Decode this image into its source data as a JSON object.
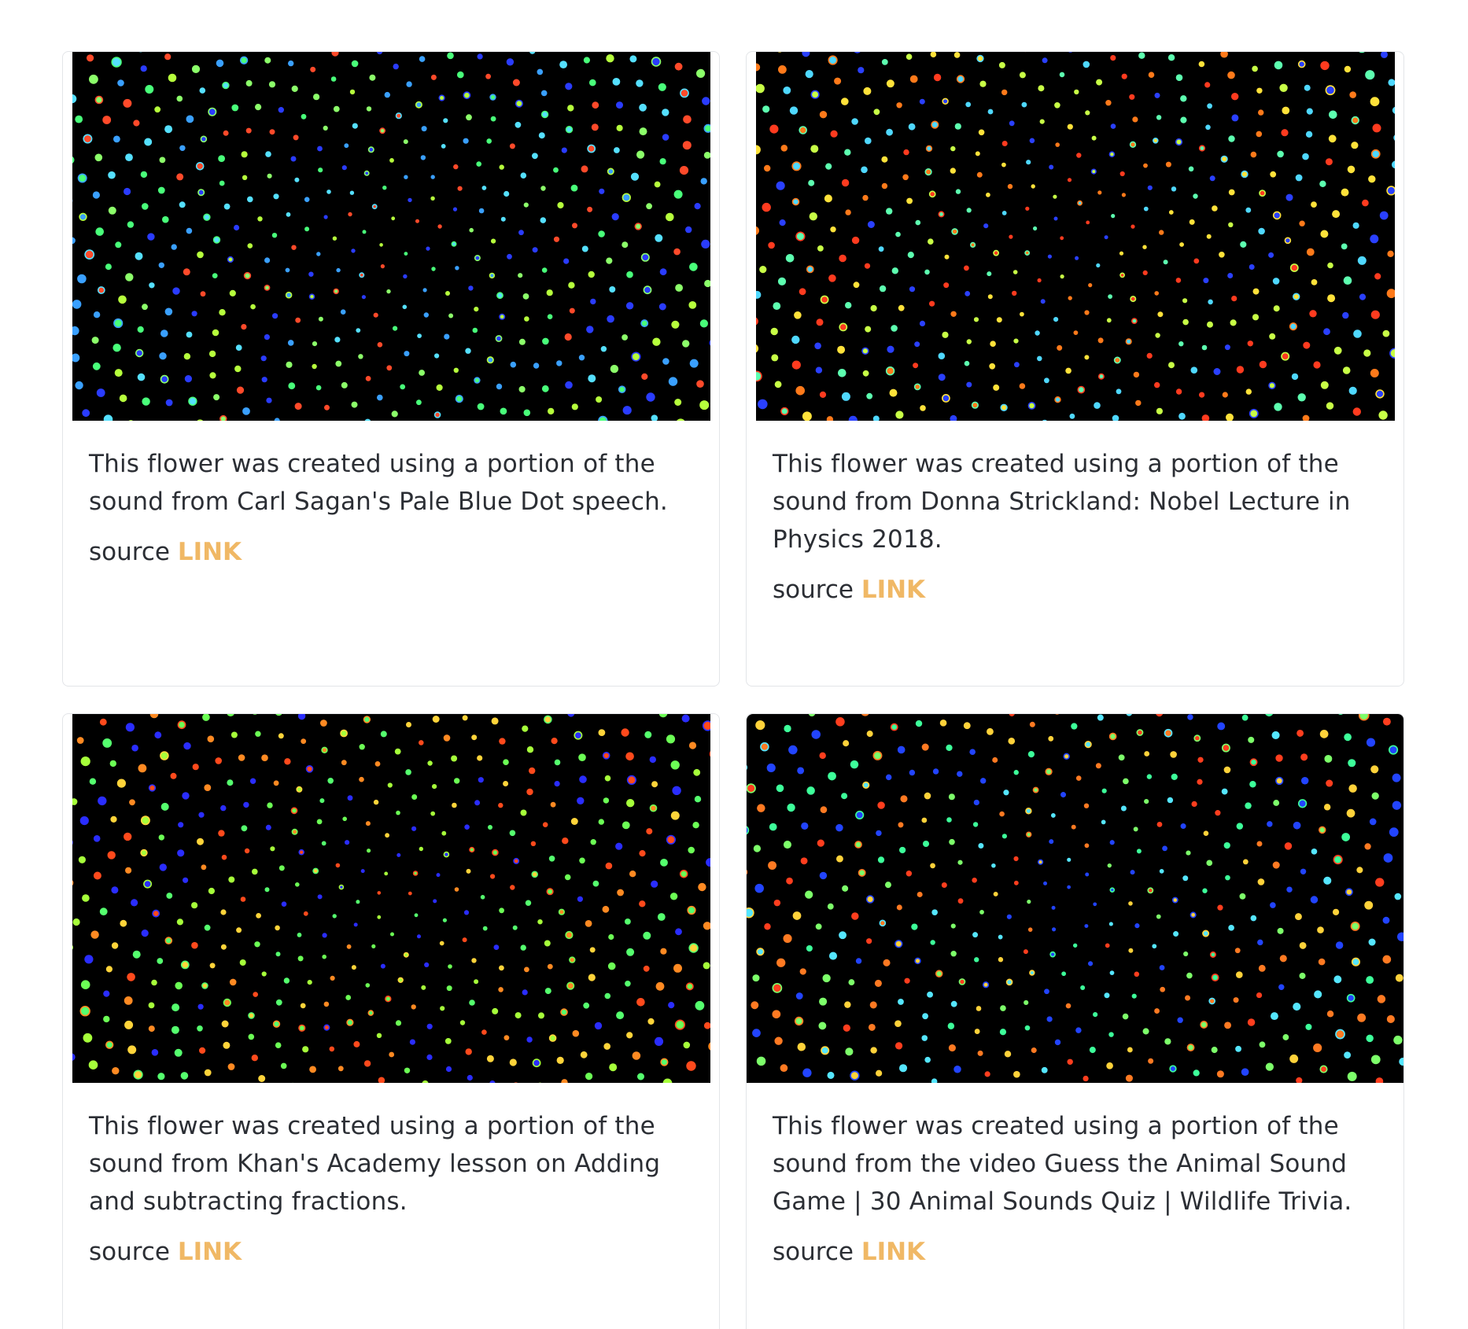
{
  "cards": [
    {
      "description": "This flower was created using a portion of the sound from Carl Sagan's Pale Blue Dot speech.",
      "source_label": "source",
      "link_label": "LINK",
      "palette": [
        "#2a3cff",
        "#3aa0ff",
        "#55e0ff",
        "#8cff6a",
        "#b6ff3c",
        "#49ff7a",
        "#ff4a2a"
      ]
    },
    {
      "description": "This flower was created using a portion of the sound from Donna Strickland: Nobel Lecture in Physics 2018.",
      "source_label": "source",
      "link_label": "LINK",
      "palette": [
        "#ff3b1f",
        "#ff7a1a",
        "#ffe23a",
        "#c8ff46",
        "#5dffb0",
        "#4fd8ff",
        "#2a40ff"
      ]
    },
    {
      "description": "This flower was created using a portion of the sound from Khan's Academy lesson on Adding and subtracting fractions.",
      "source_label": "source",
      "link_label": "LINK",
      "palette": [
        "#2a2dff",
        "#6cff55",
        "#55ff6e",
        "#a6ff3a",
        "#ff4a1c",
        "#ff8a22",
        "#ffd43a"
      ]
    },
    {
      "description": "This flower was created using a portion of the sound from the video  Guess the Animal Sound Game | 30 Animal Sounds Quiz | Wildlife Trivia.",
      "source_label": "source",
      "link_label": "LINK",
      "palette": [
        "#2244ff",
        "#55e6ff",
        "#7dff6a",
        "#3dff9a",
        "#ffd23a",
        "#ff7a22",
        "#ff3e1e"
      ]
    }
  ]
}
